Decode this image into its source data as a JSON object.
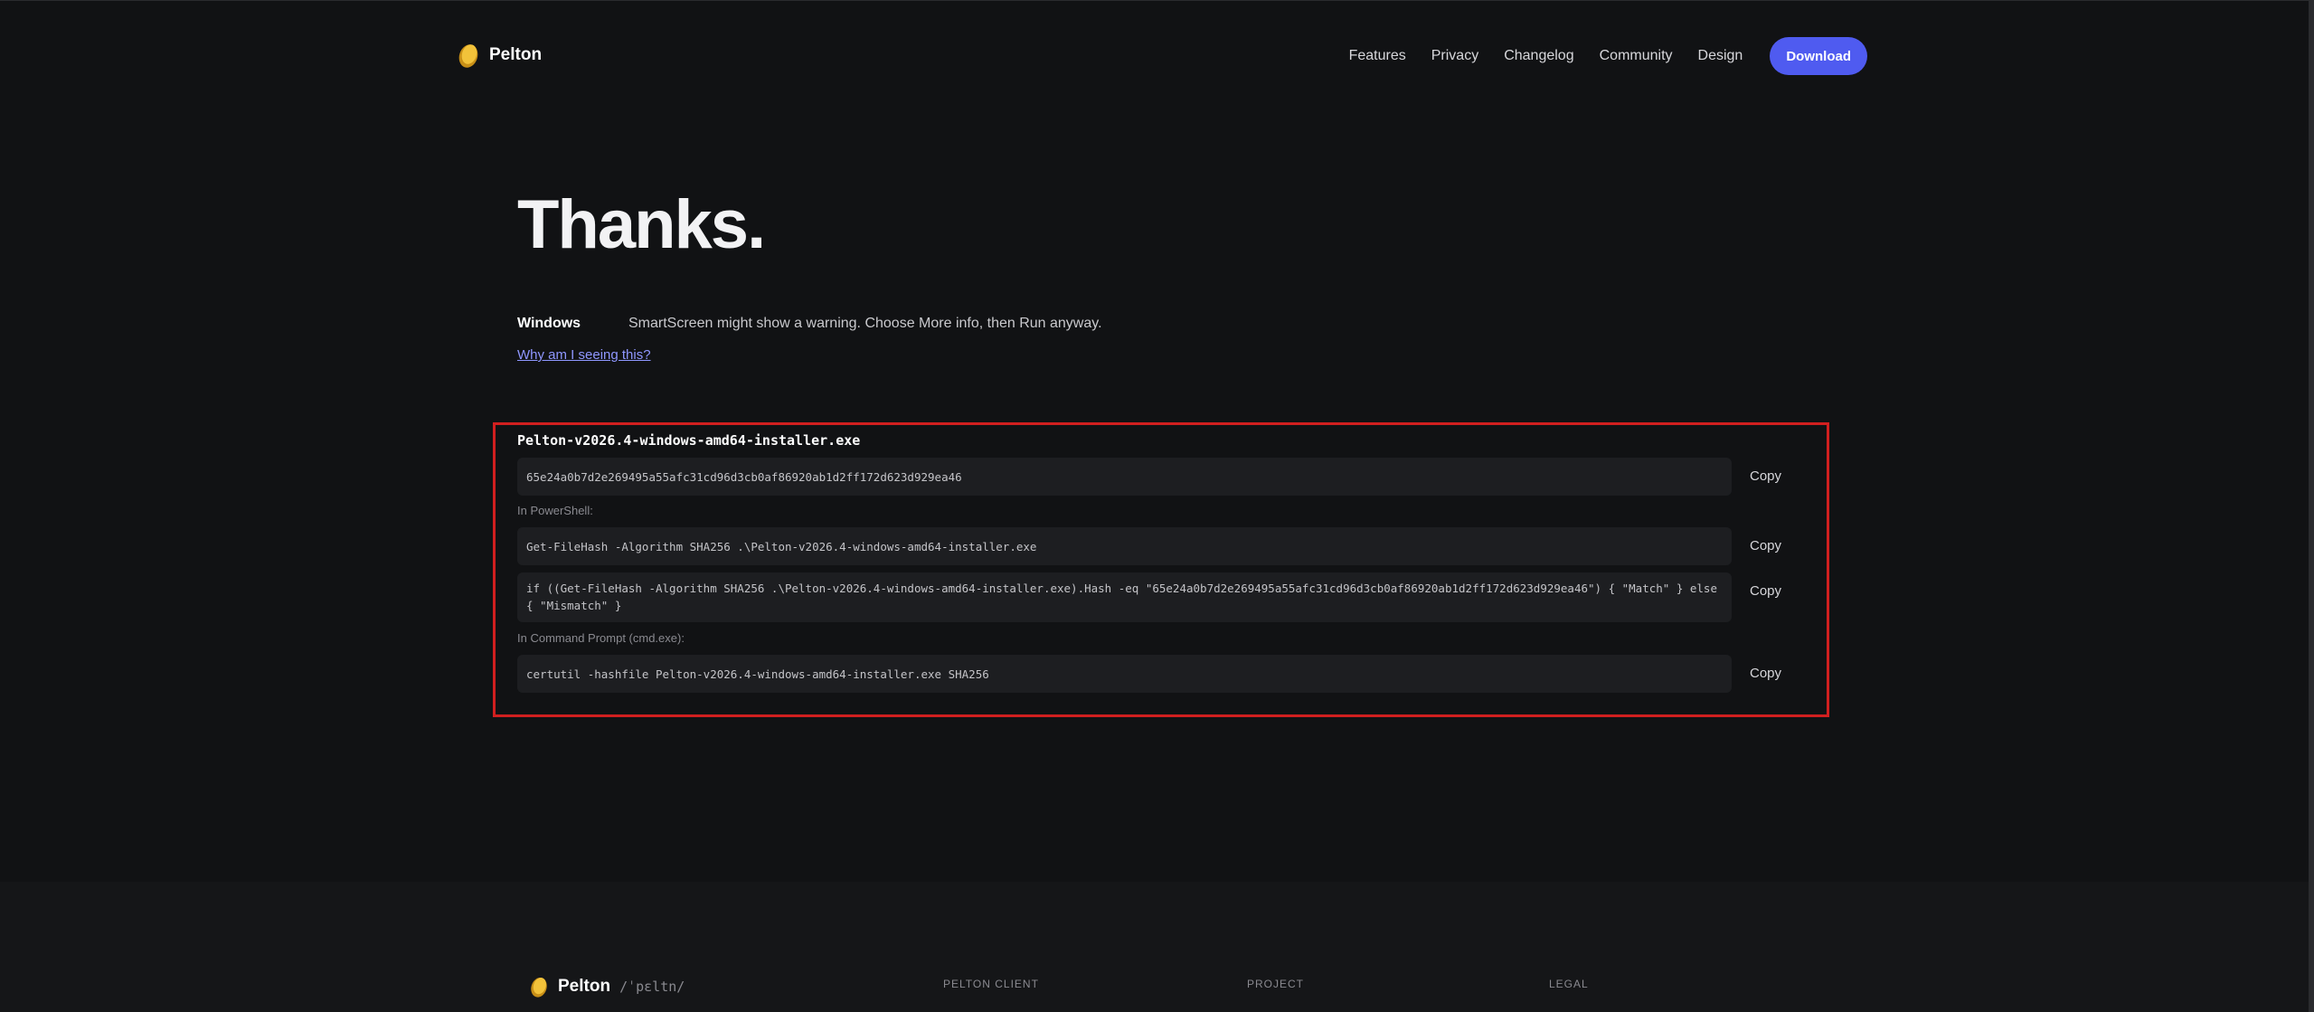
{
  "nav": {
    "brand": "Pelton",
    "links": [
      "Features",
      "Privacy",
      "Changelog",
      "Community",
      "Design"
    ],
    "download_label": "Download"
  },
  "main": {
    "title": "Thanks.",
    "os_label": "Windows",
    "os_note": "SmartScreen might show a warning. Choose More info, then Run anyway.",
    "why_link": "Why am I seeing this?"
  },
  "verify": {
    "filename": "Pelton-v2026.4-windows-amd64-installer.exe",
    "hash": "65e24a0b7d2e269495a55afc31cd96d3cb0af86920ab1d2ff172d623d929ea46",
    "powershell_label": "In PowerShell:",
    "powershell_cmd": "Get-FileHash -Algorithm SHA256 .\\Pelton-v2026.4-windows-amd64-installer.exe",
    "powershell_check": "if ((Get-FileHash -Algorithm SHA256 .\\Pelton-v2026.4-windows-amd64-installer.exe).Hash -eq \"65e24a0b7d2e269495a55afc31cd96d3cb0af86920ab1d2ff172d623d929ea46\") { \"Match\" } else { \"Mismatch\" }",
    "cmd_label": "In Command Prompt (cmd.exe):",
    "cmd_cmd": "certutil -hashfile Pelton-v2026.4-windows-amd64-installer.exe SHA256",
    "copy_label": "Copy"
  },
  "footer": {
    "brand": "Pelton",
    "pronunciation": "/ˈpɛltn/",
    "col1": "PELTON CLIENT",
    "col2": "PROJECT",
    "col3": "LEGAL"
  },
  "colors": {
    "background": "#111214",
    "accent": "#4f5bf0",
    "link": "#8f97ff",
    "highlight_border": "#d11f1f",
    "code_bg": "#1d1e21"
  },
  "icons": {
    "logo": "pelton-logo-icon"
  }
}
